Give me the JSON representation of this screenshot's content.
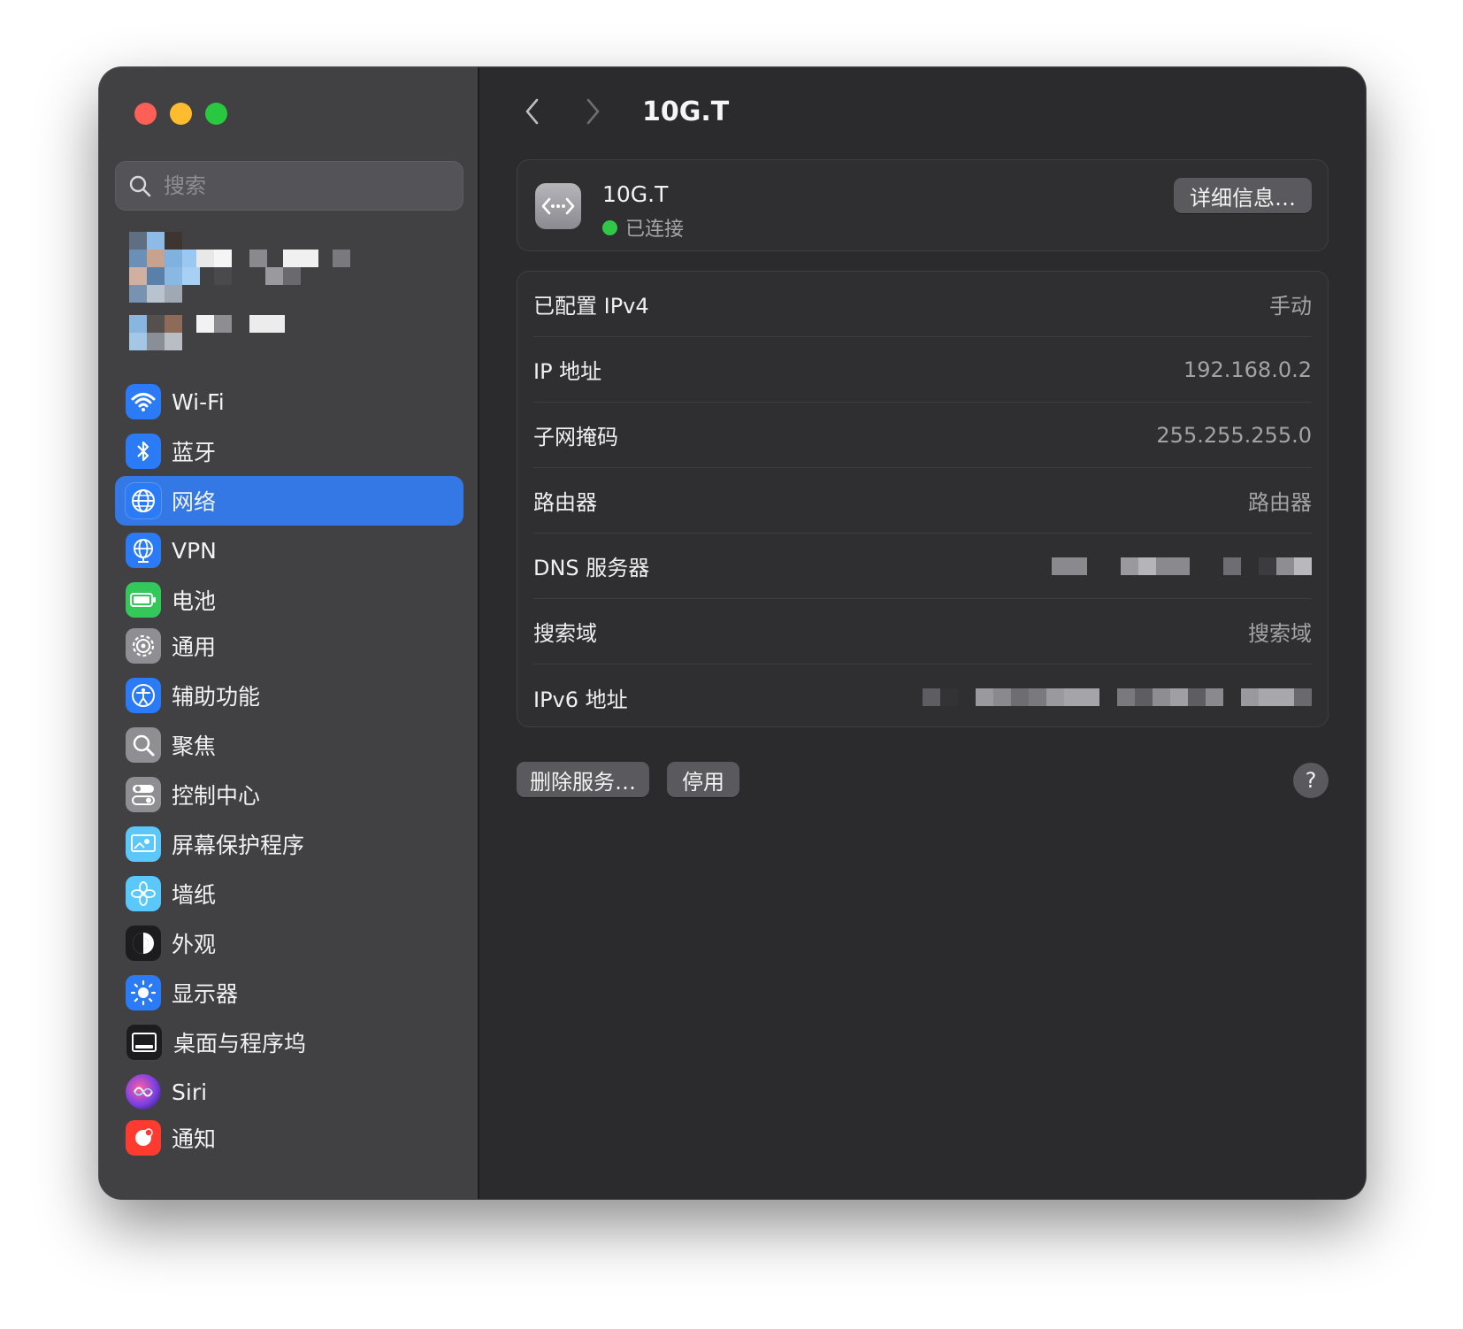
{
  "window": {
    "title": "10G.T"
  },
  "search": {
    "placeholder": "搜索"
  },
  "sidebar": {
    "groups": [
      [
        {
          "label": "Wi-Fi",
          "icon": "wifi-icon",
          "color": "#2a7bf5"
        },
        {
          "label": "蓝牙",
          "icon": "bluetooth-icon",
          "color": "#2a7bf5"
        },
        {
          "label": "网络",
          "icon": "globe-icon",
          "color": "#2a7bf5",
          "active": true
        },
        {
          "label": "VPN",
          "icon": "vpn-globe-icon",
          "color": "#2a7bf5"
        },
        {
          "label": "电池",
          "icon": "battery-icon",
          "color": "#34c759"
        }
      ],
      [
        {
          "label": "通用",
          "icon": "gear-icon",
          "color": "#8e8e93"
        },
        {
          "label": "辅助功能",
          "icon": "accessibility-icon",
          "color": "#2a7bf5"
        },
        {
          "label": "聚焦",
          "icon": "magnifier-icon",
          "color": "#8e8e93"
        },
        {
          "label": "控制中心",
          "icon": "toggles-icon",
          "color": "#8e8e93"
        },
        {
          "label": "屏幕保护程序",
          "icon": "screensaver-icon",
          "color": "#5ac8fa"
        },
        {
          "label": "墙纸",
          "icon": "flower-icon",
          "color": "#5ac8fa"
        },
        {
          "label": "外观",
          "icon": "appearance-icon",
          "color": "#1c1c1e"
        },
        {
          "label": "显示器",
          "icon": "sun-icon",
          "color": "#2a7bf5"
        },
        {
          "label": "桌面与程序坞",
          "icon": "dock-icon",
          "color": "#1c1c1e"
        },
        {
          "label": "Siri",
          "icon": "siri-icon",
          "color": "#7b3fe4"
        }
      ],
      [
        {
          "label": "通知",
          "icon": "bell-icon",
          "color": "#ff3b30"
        }
      ]
    ]
  },
  "service": {
    "name": "10G.T",
    "status": "已连接",
    "details_button": "详细信息…"
  },
  "details": [
    {
      "label": "已配置 IPv4",
      "value": "手动"
    },
    {
      "label": "IP 地址",
      "value": "192.168.0.2"
    },
    {
      "label": "子网掩码",
      "value": "255.255.255.0"
    },
    {
      "label": "路由器",
      "value": "路由器"
    },
    {
      "label": "DNS 服务器",
      "value": null
    },
    {
      "label": "搜索域",
      "value": "搜索域"
    },
    {
      "label": "IPv6 地址",
      "value": null
    }
  ],
  "actions": {
    "remove": "删除服务…",
    "disable": "停用",
    "help": "?"
  },
  "colors": {
    "accent": "#3478e5",
    "connected": "#31c84a"
  }
}
